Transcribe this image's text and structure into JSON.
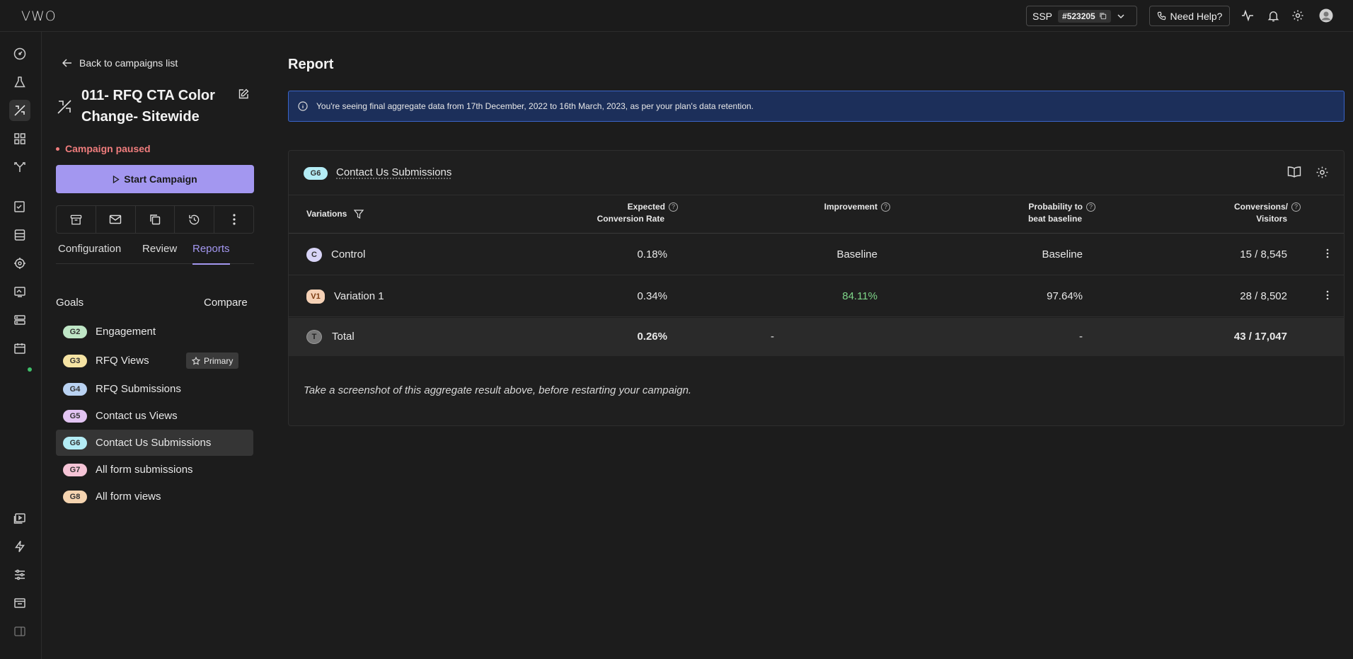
{
  "topbar": {
    "logo": "VWO",
    "account_name": "SSP",
    "account_id": "#523205",
    "help_label": "Need Help?"
  },
  "sidebar": {
    "back_label": "Back to campaigns list",
    "campaign_title": "011- RFQ CTA Color Change- Sitewide",
    "status": "Campaign paused",
    "start_label": "Start Campaign",
    "tabs": [
      {
        "label": "Configuration",
        "active": false
      },
      {
        "label": "Review",
        "active": false
      },
      {
        "label": "Reports",
        "active": true
      }
    ],
    "goals_label": "Goals",
    "compare_label": "Compare",
    "primary_label": "Primary",
    "goals": [
      {
        "tag": "G2",
        "name": "Engagement",
        "color": "#bfe6c6"
      },
      {
        "tag": "G3",
        "name": "RFQ Views",
        "color": "#f5e3a3"
      },
      {
        "tag": "G4",
        "name": "RFQ Submissions",
        "color": "#b9d2f2"
      },
      {
        "tag": "G5",
        "name": "Contact us Views",
        "color": "#e2c4f2"
      },
      {
        "tag": "G6",
        "name": "Contact Us Submissions",
        "color": "#b3ecf5"
      },
      {
        "tag": "G7",
        "name": "All form submissions",
        "color": "#f5c4d6"
      },
      {
        "tag": "G8",
        "name": "All form views",
        "color": "#f5d4b0"
      }
    ]
  },
  "main": {
    "title": "Report",
    "banner": "You're seeing final aggregate data from 17th December, 2022 to 16th March, 2023, as per your plan's data retention.",
    "card": {
      "goal_tag": "G6",
      "goal_name": "Contact Us Submissions",
      "columns": {
        "variations": "Variations",
        "expected_1": "Expected",
        "expected_2": "Conversion Rate",
        "improvement": "Improvement",
        "probability_1": "Probability to",
        "probability_2": "beat baseline",
        "conversions_1": "Conversions/",
        "conversions_2": "Visitors"
      },
      "rows": [
        {
          "tag": "C",
          "name": "Control",
          "rate": "0.18%",
          "improvement": "Baseline",
          "probability": "Baseline",
          "conversions": "15 / 8,545",
          "tag_color": "#d8d4f7"
        },
        {
          "tag": "V1",
          "name": "Variation 1",
          "rate": "0.34%",
          "improvement": "84.11%",
          "probability": "97.64%",
          "conversions": "28 / 8,502",
          "tag_color": "#f5d1b6"
        }
      ],
      "total": {
        "tag": "T",
        "name": "Total",
        "rate": "0.26%",
        "improvement": "-",
        "probability": "-",
        "conversions": "43 / 17,047"
      },
      "note": "Take a screenshot of this aggregate result above, before restarting your campaign."
    }
  }
}
